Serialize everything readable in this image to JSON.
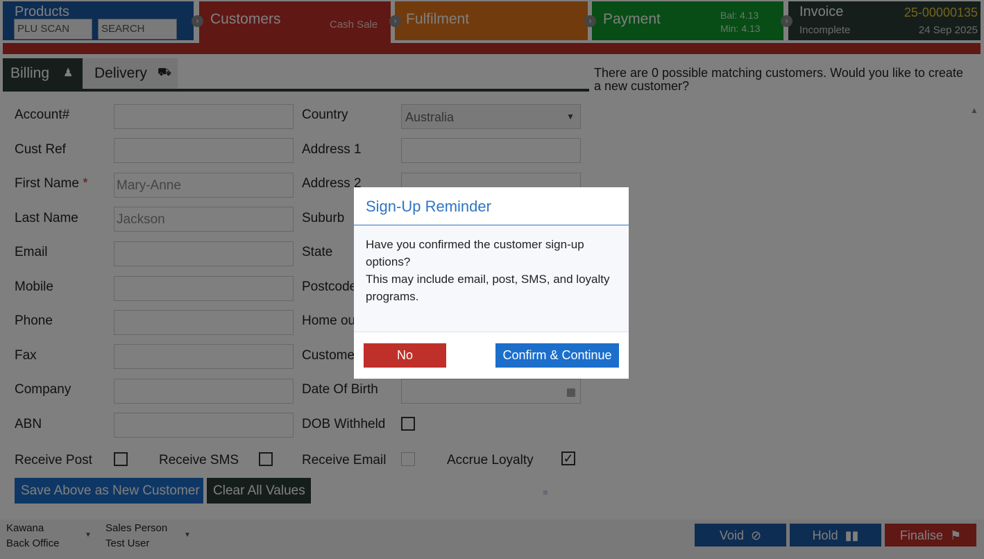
{
  "steps": {
    "products": {
      "title": "Products",
      "plu_placeholder": "PLU SCAN",
      "search_placeholder": "SEARCH"
    },
    "customers": {
      "title": "Customers",
      "sub": "Cash Sale"
    },
    "fulfilment": {
      "title": "Fulfilment"
    },
    "payment": {
      "title": "Payment",
      "bal": "Bal:  4.13",
      "min": "Min:  4.13"
    },
    "invoice": {
      "title": "Invoice",
      "status": "Incomplete",
      "number": "25-00000135",
      "date": "24 Sep 2025"
    }
  },
  "tabs": {
    "billing": "Billing",
    "delivery": "Delivery"
  },
  "match_message": "There are 0 possible matching customers. Would you like to create a new customer?",
  "form": {
    "labels": {
      "account": "Account#",
      "cust_ref": "Cust Ref",
      "first_name": "First Name",
      "required_mark": "*",
      "last_name": "Last Name",
      "email": "Email",
      "mobile": "Mobile",
      "phone": "Phone",
      "fax": "Fax",
      "company": "Company",
      "abn": "ABN",
      "country": "Country",
      "address1": "Address 1",
      "address2": "Address 2",
      "suburb": "Suburb",
      "state": "State",
      "postcode": "Postcode",
      "home_outlet": "Home ou",
      "customer": "Custome",
      "dob": "Date Of Birth",
      "dob_withheld": "DOB Withheld",
      "receive_post": "Receive Post",
      "receive_sms": "Receive SMS",
      "receive_email": "Receive Email",
      "accrue_loyalty": "Accrue Loyalty"
    },
    "values": {
      "first_name": "Mary-Anne",
      "last_name": "Jackson",
      "country": "Australia"
    },
    "checks": {
      "accrue_loyalty": "✓"
    },
    "save_button": "Save Above as New Customer",
    "clear_button": "Clear All Values"
  },
  "bottom": {
    "location": "Kawana",
    "role": "Back Office",
    "sales_person_label": "Sales Person",
    "sales_person": "Test User",
    "void": "Void",
    "hold": "Hold",
    "finalise": "Finalise"
  },
  "modal": {
    "title": "Sign-Up Reminder",
    "body1": "Have you confirmed the customer sign-up options?",
    "body2": "This may include email, post, SMS, and loyalty programs.",
    "no": "No",
    "confirm": "Confirm & Continue"
  },
  "colors": {
    "blue": "#1c5aa6",
    "red": "#c0302a",
    "orange": "#e2761b",
    "green": "#0e9a2b",
    "dark": "#2a3d35"
  }
}
